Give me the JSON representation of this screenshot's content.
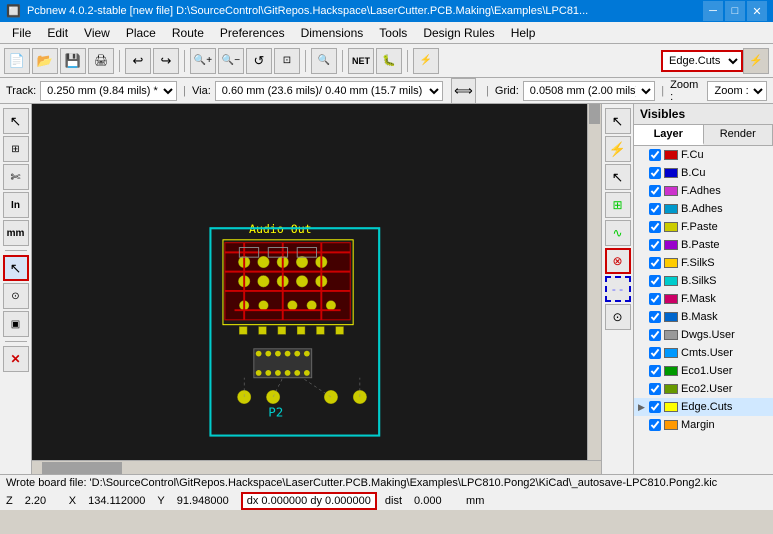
{
  "titlebar": {
    "title": "Pcbnew 4.0.2-stable  [new file] D:\\SourceControl\\GitRepos.Hackspace\\LaserCutter.PCB.Making\\Examples\\LPC81...",
    "min_btn": "─",
    "max_btn": "□",
    "close_btn": "✕"
  },
  "menubar": {
    "items": [
      "File",
      "Edit",
      "View",
      "Place",
      "Route",
      "Preferences",
      "Dimensions",
      "Tools",
      "Design Rules",
      "Help"
    ]
  },
  "toolbar": {
    "buttons": [
      {
        "icon": "📄",
        "name": "new"
      },
      {
        "icon": "📁",
        "name": "open"
      },
      {
        "icon": "💾",
        "name": "save"
      },
      {
        "icon": "🖨",
        "name": "print"
      },
      {
        "sep": true
      },
      {
        "icon": "↩",
        "name": "undo"
      },
      {
        "icon": "↪",
        "name": "redo"
      },
      {
        "sep": true
      },
      {
        "icon": "🔍+",
        "name": "zoom-in"
      },
      {
        "icon": "🔍-",
        "name": "zoom-out"
      },
      {
        "icon": "↺",
        "name": "refresh"
      },
      {
        "icon": "🔍",
        "name": "zoom-fit"
      },
      {
        "sep": true
      },
      {
        "icon": "🔍",
        "name": "zoom-box"
      },
      {
        "sep": true
      },
      {
        "icon": "NET",
        "name": "netlist"
      },
      {
        "icon": "🐛",
        "name": "drc"
      },
      {
        "sep": true
      },
      {
        "icon": "⚡",
        "name": "ratsnest"
      }
    ]
  },
  "trackbar": {
    "track_label": "Track:",
    "track_value": "0.250 mm (9.84 mils) *",
    "via_label": "Via:",
    "via_value": "0.60 mm (23.6 mils)/ 0.40 mm (15.7 mils) *",
    "route_icon": "⟺",
    "grid_label": "Grid:",
    "grid_value": "0.0508 mm (2.00 mils)",
    "zoom_label": "Zoom :"
  },
  "layer_selector": {
    "value": "Edge.Cuts",
    "options": [
      "F.Cu",
      "B.Cu",
      "F.Adhes",
      "B.Adhes",
      "F.Paste",
      "B.Paste",
      "F.SilkS",
      "B.SilkS",
      "F.Mask",
      "B.Mask",
      "Dwgs.User",
      "Cmts.User",
      "Eco1.User",
      "Eco2.User",
      "Edge.Cuts",
      "Margin"
    ]
  },
  "left_toolbar": {
    "buttons": [
      {
        "icon": "↖",
        "name": "select",
        "active": false
      },
      {
        "icon": "⊞",
        "name": "route-tracks"
      },
      {
        "icon": "✄",
        "name": "cut"
      },
      {
        "icon": "In",
        "name": "inspect"
      },
      {
        "icon": "mm",
        "name": "units"
      },
      {
        "icon": "↖",
        "name": "select-arrow",
        "active": true,
        "highlight": true
      },
      {
        "icon": "⊙",
        "name": "add-via"
      },
      {
        "icon": "▣",
        "name": "footprint"
      },
      {
        "icon": "✕",
        "name": "delete",
        "highlight": false
      }
    ]
  },
  "right_toolbar": {
    "buttons": [
      {
        "icon": "↖",
        "name": "select-rt"
      },
      {
        "icon": "⚡",
        "name": "highlight-net"
      },
      {
        "icon": "↖",
        "name": "interactive-router"
      },
      {
        "icon": "⊞",
        "name": "add-tracks"
      },
      {
        "icon": "∿",
        "name": "draw"
      },
      {
        "icon": "⊗",
        "name": "no-connect",
        "highlight": true
      },
      {
        "icon": "✒",
        "name": "dashed-line",
        "blue_highlight": true
      },
      {
        "icon": "⊙",
        "name": "via-rt"
      }
    ]
  },
  "visibles": {
    "header": "Visibles",
    "tabs": [
      "Layer",
      "Render"
    ],
    "active_tab": "Layer",
    "layers": [
      {
        "name": "F.Cu",
        "color": "#cc0000",
        "checked": true,
        "selected": false
      },
      {
        "name": "B.Cu",
        "color": "#0000cc",
        "checked": true,
        "selected": false
      },
      {
        "name": "F.Adhes",
        "color": "#cc33cc",
        "checked": true,
        "selected": false
      },
      {
        "name": "B.Adhes",
        "color": "#0099cc",
        "checked": true,
        "selected": false
      },
      {
        "name": "F.Paste",
        "color": "#cccc00",
        "checked": true,
        "selected": false
      },
      {
        "name": "B.Paste",
        "color": "#9900cc",
        "checked": true,
        "selected": false
      },
      {
        "name": "F.SilkS",
        "color": "#ffcc00",
        "checked": true,
        "selected": false
      },
      {
        "name": "B.SilkS",
        "color": "#00cccc",
        "checked": true,
        "selected": false
      },
      {
        "name": "F.Mask",
        "color": "#cc0066",
        "checked": true,
        "selected": false
      },
      {
        "name": "B.Mask",
        "color": "#0066cc",
        "checked": true,
        "selected": false
      },
      {
        "name": "Dwgs.User",
        "color": "#999999",
        "checked": true,
        "selected": false
      },
      {
        "name": "Cmts.User",
        "color": "#0099ff",
        "checked": true,
        "selected": false
      },
      {
        "name": "Eco1.User",
        "color": "#009900",
        "checked": true,
        "selected": false
      },
      {
        "name": "Eco2.User",
        "color": "#669900",
        "checked": true,
        "selected": false
      },
      {
        "name": "Edge.Cuts",
        "color": "#ffff00",
        "checked": true,
        "selected": true
      },
      {
        "name": "Margin",
        "color": "#ff9900",
        "checked": true,
        "selected": false
      }
    ]
  },
  "statusbar": {
    "line1": "Wrote board file: 'D:\\SourceControl\\GitRepos.Hackspace\\LaserCutter.PCB.Making\\Examples\\LPC810.Pong2\\KiCad\\_autosave-LPC810.Pong2.kic",
    "z_label": "Z",
    "z_value": "2.20",
    "x_label": "X",
    "x_value": "134.112000",
    "y_label": "Y",
    "y_value": "91.948000",
    "dx_label": "dx",
    "dx_value": "0.000000",
    "dy_label": "dy",
    "dy_value": "0.000000",
    "dist_label": "dist",
    "dist_value": "0.000",
    "units": "mm"
  },
  "pcb": {
    "bg_color": "#1a1a1a",
    "outline_color": "#00cccc",
    "copper_color": "#cc0000",
    "silk_color": "#ffff00",
    "pad_color": "#cccc00",
    "label_color": "#ffff00",
    "label_text": "Audio Out",
    "ref_text": "P2"
  }
}
